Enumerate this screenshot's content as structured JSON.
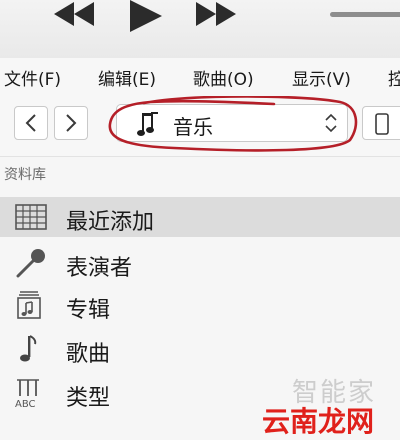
{
  "toolbar": {
    "buttons": [
      {
        "name": "previous",
        "icon": "rewind-icon"
      },
      {
        "name": "play",
        "icon": "play-icon"
      },
      {
        "name": "next",
        "icon": "fast-forward-icon"
      }
    ],
    "volume_icon": "volume-slider"
  },
  "menu": {
    "items": [
      "文件(F)",
      "编辑(E)",
      "歌曲(O)",
      "显示(V)",
      "控"
    ]
  },
  "nav": {
    "back_icon": "chevron-left-icon",
    "forward_icon": "chevron-right-icon",
    "media_selector": {
      "icon": "music-note-icon",
      "label": "音乐",
      "arrow_icon": "up-down-arrows-icon"
    },
    "device_icon": "iphone-icon",
    "annotation_color": "#b51f28"
  },
  "library": {
    "header": "资料库",
    "items": [
      {
        "label": "最近添加",
        "icon": "recently-added-grid-icon",
        "selected": true
      },
      {
        "label": "表演者",
        "icon": "microphone-icon",
        "selected": false
      },
      {
        "label": "专辑",
        "icon": "album-icon",
        "selected": false
      },
      {
        "label": "歌曲",
        "icon": "music-note-icon",
        "selected": false
      },
      {
        "label": "类型",
        "icon": "genre-icon",
        "selected": false
      }
    ],
    "selected_bg": "#dcdcdc"
  },
  "watermark": {
    "top": "智能家",
    "bottom": "云南龙网",
    "bottom_color": "#e0211b"
  }
}
